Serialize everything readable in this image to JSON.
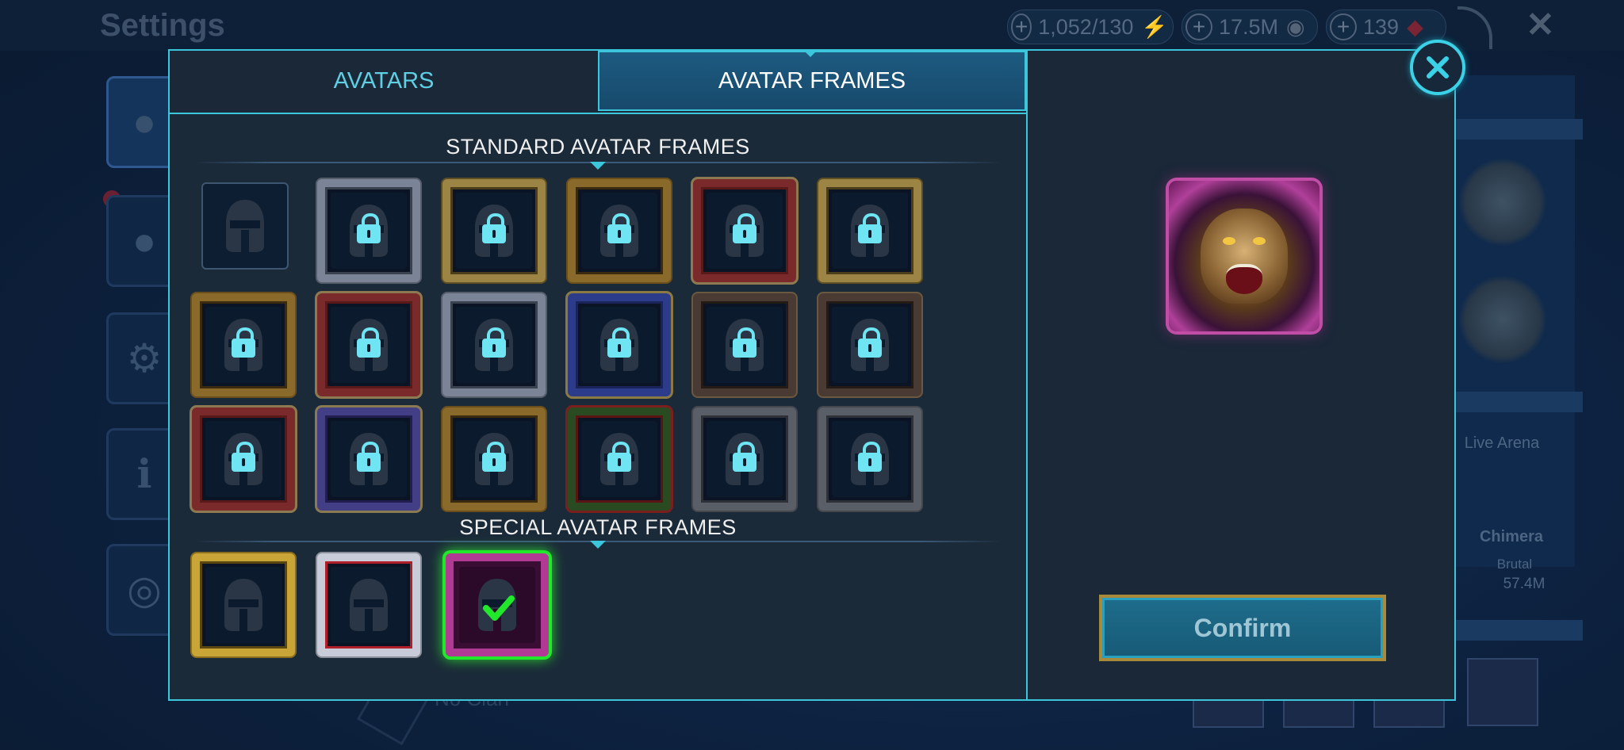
{
  "background": {
    "title": "Settings",
    "resources": {
      "energy": "1,052/130",
      "silver": "17.5M",
      "gems": "139"
    },
    "right_panel": {
      "mode_label": "Live Arena",
      "champion_name": "Chimera",
      "difficulty": "Brutal",
      "power": "57.4M"
    },
    "clan_label": "No Clan"
  },
  "tabs": {
    "avatars": "AVATARS",
    "avatar_frames": "AVATAR FRAMES",
    "active": "avatar_frames"
  },
  "sections": {
    "standard_title": "STANDARD AVATAR FRAMES",
    "special_title": "SPECIAL AVATAR FRAMES"
  },
  "standard_frames": [
    {
      "style": "plain",
      "locked": false
    },
    {
      "style": "silver",
      "locked": true
    },
    {
      "style": "gold",
      "locked": true
    },
    {
      "style": "bronze",
      "locked": true
    },
    {
      "style": "red",
      "locked": true
    },
    {
      "style": "gold",
      "locked": true
    },
    {
      "style": "bronze",
      "locked": true
    },
    {
      "style": "red",
      "locked": true
    },
    {
      "style": "silver",
      "locked": true
    },
    {
      "style": "blue",
      "locked": true
    },
    {
      "style": "dark",
      "locked": true
    },
    {
      "style": "dark",
      "locked": true
    },
    {
      "style": "red",
      "locked": true
    },
    {
      "style": "purple",
      "locked": true
    },
    {
      "style": "bronze",
      "locked": true
    },
    {
      "style": "green",
      "locked": true
    },
    {
      "style": "gray",
      "locked": true
    },
    {
      "style": "gray",
      "locked": true
    }
  ],
  "special_frames": [
    {
      "style": "sp-gold",
      "locked": false,
      "selected": false
    },
    {
      "style": "sp-silver",
      "locked": false,
      "selected": false
    },
    {
      "style": "sp-selected",
      "locked": false,
      "selected": true
    }
  ],
  "confirm_label": "Confirm",
  "colors": {
    "accent": "#3bc6dc",
    "selected": "#22e82c",
    "lock": "#6fe4f2"
  }
}
